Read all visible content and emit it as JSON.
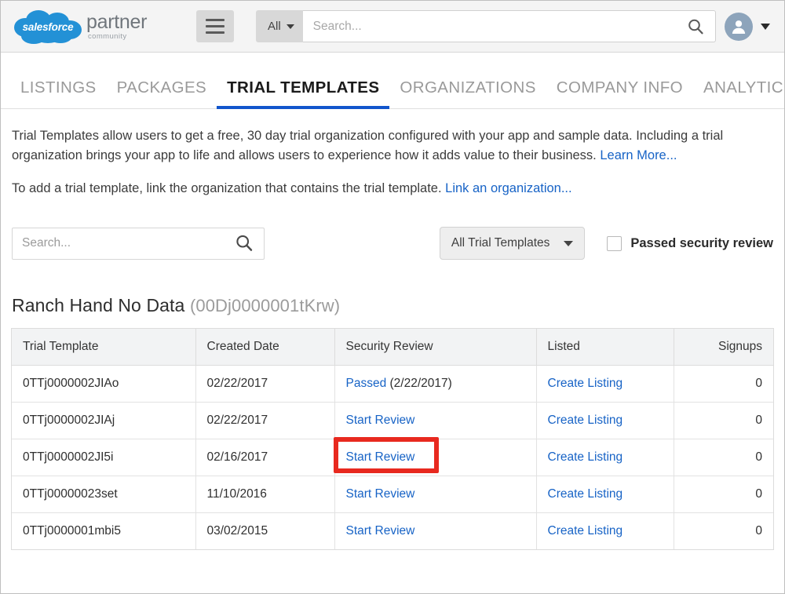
{
  "header": {
    "logo": {
      "cloud_word": "salesforce",
      "brand_main": "partner",
      "brand_sub": "community",
      "cloud_color": "#2391d6"
    },
    "menu_icon": "hamburger-menu-icon",
    "search": {
      "scope_label": "All",
      "placeholder": "Search...",
      "value": "",
      "icon": "search-icon"
    },
    "user": {
      "avatar_icon": "user-avatar-icon",
      "caret_icon": "chevron-down-icon"
    }
  },
  "tabs": [
    {
      "label": "LISTINGS",
      "active": false
    },
    {
      "label": "PACKAGES",
      "active": false
    },
    {
      "label": "TRIAL TEMPLATES",
      "active": true
    },
    {
      "label": "ORGANIZATIONS",
      "active": false
    },
    {
      "label": "COMPANY INFO",
      "active": false
    },
    {
      "label": "ANALYTICS",
      "active": false
    }
  ],
  "intro": {
    "paragraph1_part1": "Trial Templates allow users to get a free, 30 day trial organization configured with your app and sample data. Including a trial organization brings your app to life and allows users to experience how it adds value to their business. ",
    "paragraph1_link": "Learn More...",
    "paragraph2_part1": "To add a trial template, link the organization that contains the trial template. ",
    "paragraph2_link": "Link an organization..."
  },
  "filters": {
    "search_placeholder": "Search...",
    "search_value": "",
    "search_icon": "search-icon",
    "dropdown_label": "All Trial Templates",
    "dropdown_icon": "chevron-down-icon",
    "checkbox_label": "Passed security review",
    "checkbox_checked": false
  },
  "org": {
    "name": "Ranch Hand No Data",
    "id": "(00Dj0000001tKrw)"
  },
  "table": {
    "columns": [
      "Trial Template",
      "Created Date",
      "Security Review",
      "Listed",
      "Signups"
    ],
    "rows": [
      {
        "trial_template": "0TTj0000002JIAo",
        "created_date": "02/22/2017",
        "security_review_link": "Passed",
        "security_review_suffix": " (2/22/2017)",
        "listed": "Create Listing",
        "signups": "0",
        "highlighted": false
      },
      {
        "trial_template": "0TTj0000002JIAj",
        "created_date": "02/22/2017",
        "security_review_link": "Start Review",
        "security_review_suffix": "",
        "listed": "Create Listing",
        "signups": "0",
        "highlighted": true
      },
      {
        "trial_template": "0TTj0000002JI5i",
        "created_date": "02/16/2017",
        "security_review_link": "Start Review",
        "security_review_suffix": "",
        "listed": "Create Listing",
        "signups": "0",
        "highlighted": false
      },
      {
        "trial_template": "0TTj00000023set",
        "created_date": "11/10/2016",
        "security_review_link": "Start Review",
        "security_review_suffix": "",
        "listed": "Create Listing",
        "signups": "0",
        "highlighted": false
      },
      {
        "trial_template": "0TTj0000001mbi5",
        "created_date": "03/02/2015",
        "security_review_link": "Start Review",
        "security_review_suffix": "",
        "listed": "Create Listing",
        "signups": "0",
        "highlighted": false
      }
    ]
  },
  "annotation": {
    "highlight_color": "#e8291f",
    "target": "Start Review"
  }
}
